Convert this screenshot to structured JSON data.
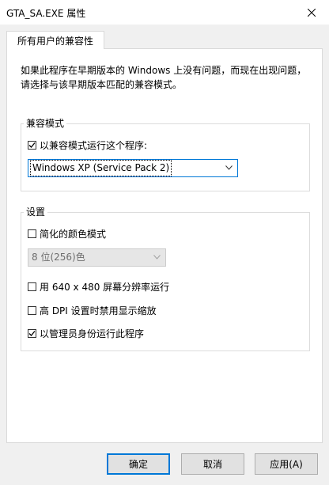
{
  "window": {
    "title": "GTA_SA.EXE 属性"
  },
  "tabs": [
    {
      "label": "所有用户的兼容性"
    }
  ],
  "description": {
    "line1": "如果此程序在早期版本的 Windows 上没有问题，而现在出现问题，",
    "line2": "请选择与该早期版本匹配的兼容模式。"
  },
  "compat_group": {
    "title": "兼容模式",
    "run_in_compat_label": "以兼容模式运行这个程序:",
    "run_in_compat_checked": true,
    "os_selected": "Windows XP (Service Pack 2)"
  },
  "settings_group": {
    "title": "设置",
    "reduced_color_label": "简化的颜色模式",
    "reduced_color_checked": false,
    "color_selected": "8 位(256)色",
    "res_640_label": "用 640 x 480 屏幕分辨率运行",
    "res_640_checked": false,
    "high_dpi_label": "高 DPI 设置时禁用显示缩放",
    "high_dpi_checked": false,
    "run_as_admin_label": "以管理员身份运行此程序",
    "run_as_admin_checked": true
  },
  "buttons": {
    "ok": "确定",
    "cancel": "取消",
    "apply": "应用(A)"
  },
  "colors": {
    "accent": "#0078d7",
    "dialog_bg": "#f0f0f0",
    "border": "#d9d9d9"
  }
}
